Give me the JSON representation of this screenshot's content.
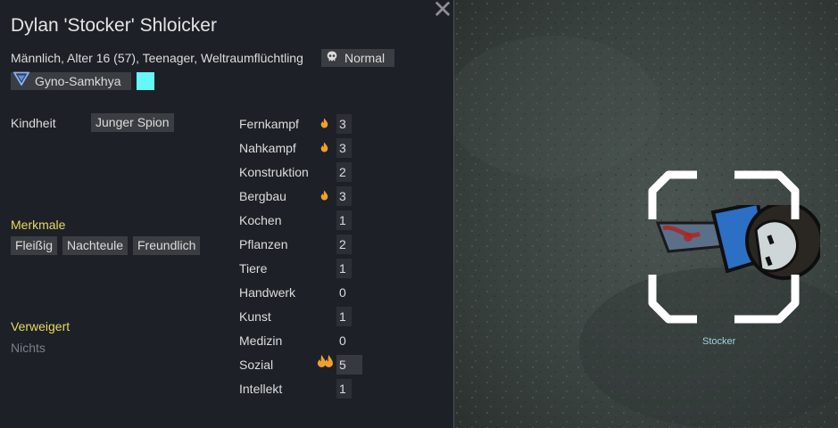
{
  "character": {
    "name": "Dylan 'Stocker' Shloicker",
    "description": "Männlich, Alter 16 (57), Teenager, Weltraumflüchtling",
    "ideo_tag": "Normal",
    "xenotype": "Gyno-Samkhya",
    "favorite_color": "#66f7f7"
  },
  "backstory": {
    "childhood_label": "Kindheit",
    "childhood_value": "Junger Spion"
  },
  "traits": {
    "heading": "Merkmale",
    "items": [
      "Fleißig",
      "Nachteule",
      "Freundlich"
    ]
  },
  "incapable": {
    "heading": "Verweigert",
    "value": "Nichts"
  },
  "skills": [
    {
      "name": "Fernkampf",
      "level": "3",
      "passion": "minor"
    },
    {
      "name": "Nahkampf",
      "level": "3",
      "passion": "minor"
    },
    {
      "name": "Konstruktion",
      "level": "2",
      "passion": "none"
    },
    {
      "name": "Bergbau",
      "level": "3",
      "passion": "minor"
    },
    {
      "name": "Kochen",
      "level": "1",
      "passion": "none"
    },
    {
      "name": "Pflanzen",
      "level": "2",
      "passion": "none"
    },
    {
      "name": "Tiere",
      "level": "1",
      "passion": "none"
    },
    {
      "name": "Handwerk",
      "level": "0",
      "passion": "none"
    },
    {
      "name": "Kunst",
      "level": "1",
      "passion": "none"
    },
    {
      "name": "Medizin",
      "level": "0",
      "passion": "none"
    },
    {
      "name": "Sozial",
      "level": "5",
      "passion": "major"
    },
    {
      "name": "Intellekt",
      "level": "1",
      "passion": "none"
    }
  ],
  "game_view": {
    "pawn_label": "Stocker"
  },
  "colors": {
    "panel_bg": "#1d2127",
    "section_heading": "#e8d861",
    "flame": "#f0a030",
    "selection_bracket": "#ffffff"
  }
}
